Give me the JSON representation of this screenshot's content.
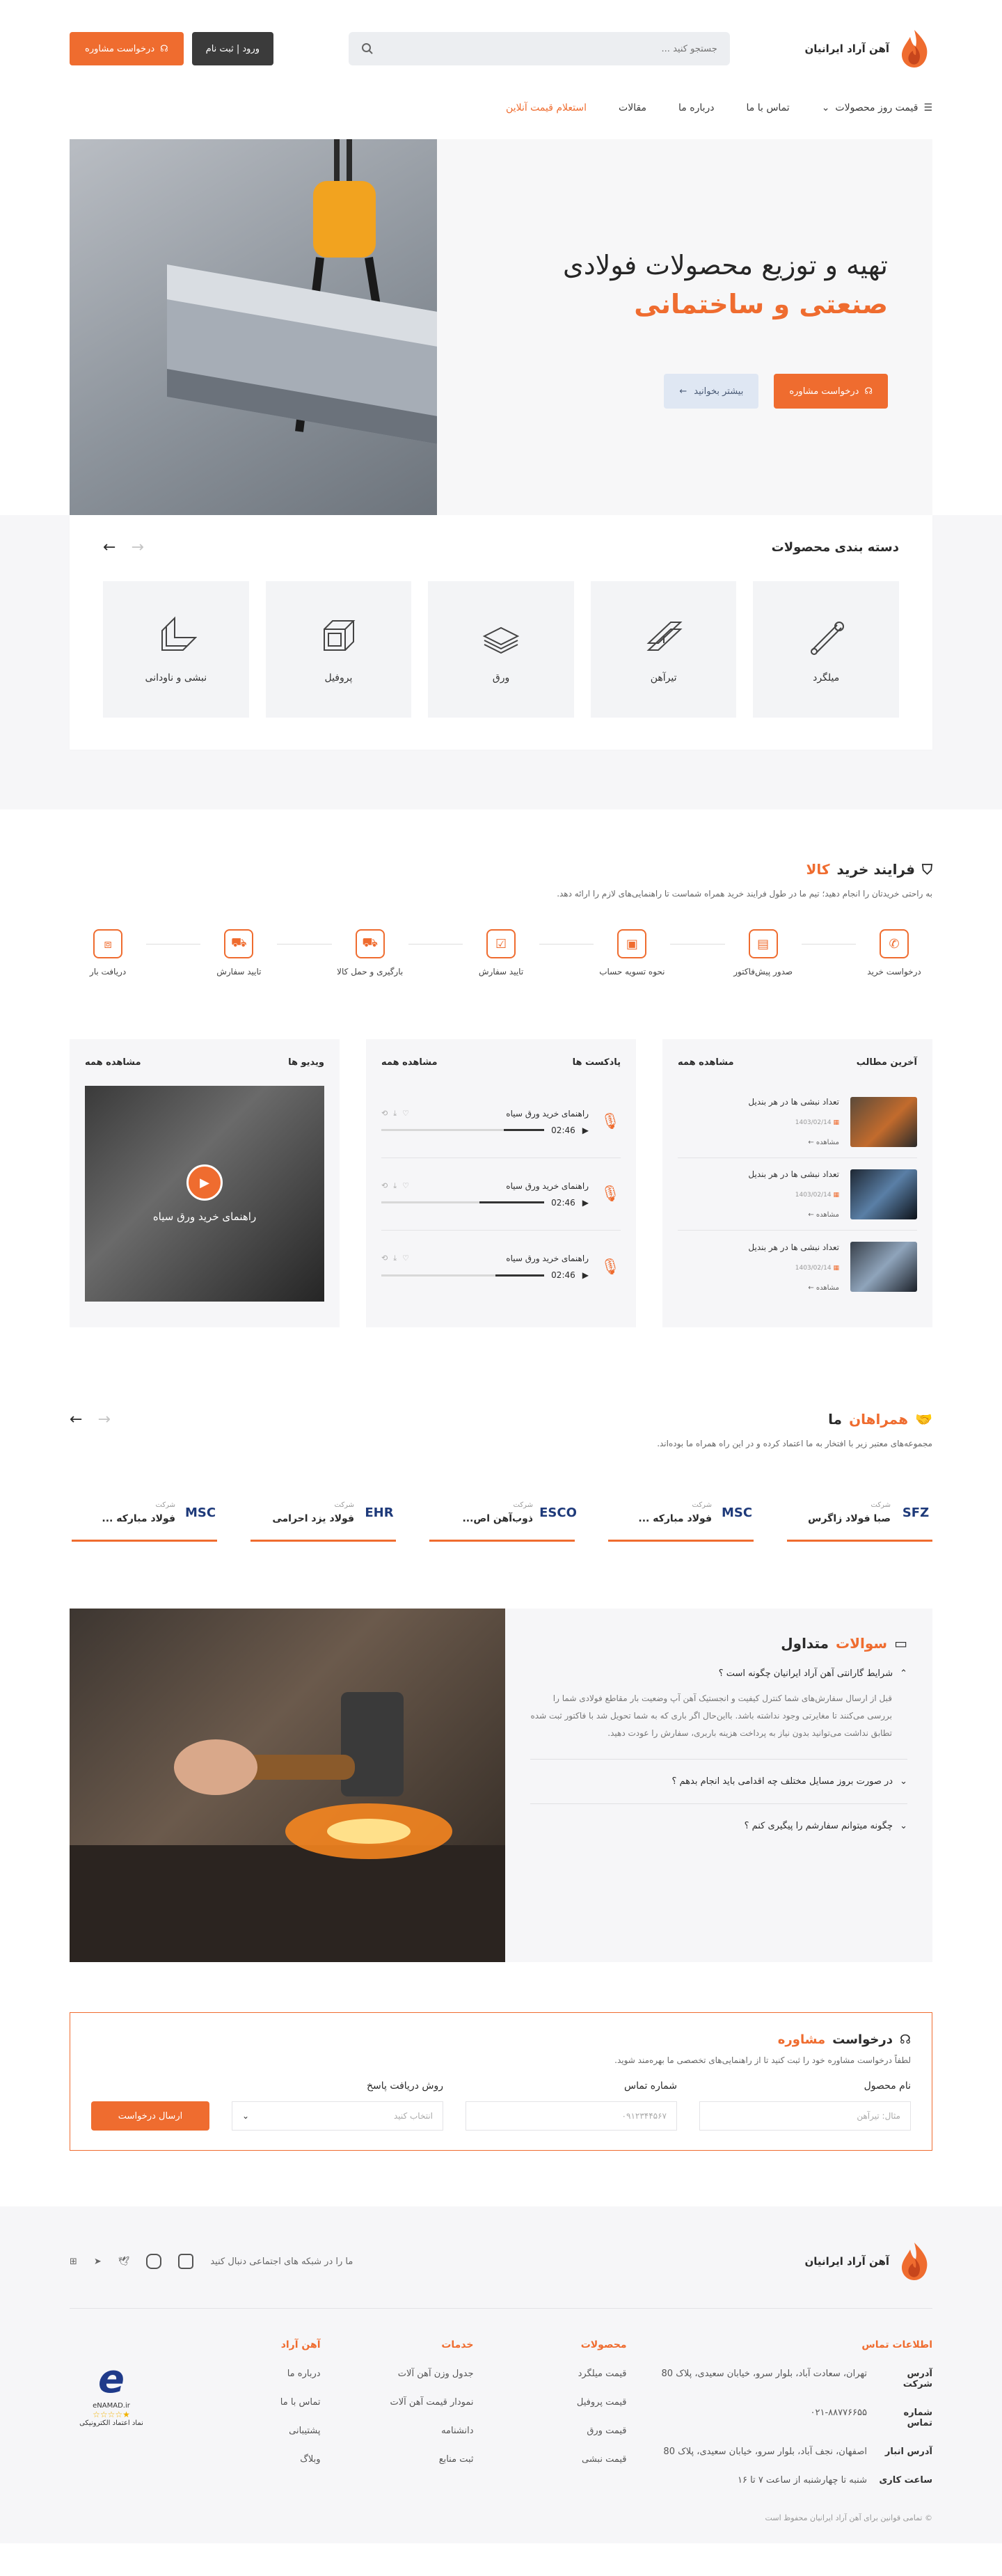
{
  "header": {
    "logo_text": "آهن آراد ایرانیان",
    "search_placeholder": "جستجو کنید ...",
    "login_label": "ورود | ثبت نام",
    "consult_label": "درخواست مشاوره"
  },
  "nav": {
    "items": [
      {
        "label": "قیمت روز محصولات"
      },
      {
        "label": "تماس با ما"
      },
      {
        "label": "درباره ما"
      },
      {
        "label": "مقالات"
      },
      {
        "label": "استعلام قیمت آنلاین"
      }
    ]
  },
  "hero": {
    "line1": "تهیه و توزیع محصولات فولادی",
    "line2": "صنعتی و ساختمانی",
    "consult_label": "درخواست مشاوره",
    "more_label": "بیشتر بخوانید"
  },
  "categories": {
    "title": "دسته بندی محصولات",
    "items": [
      {
        "label": "میلگرد"
      },
      {
        "label": "تیرآهن"
      },
      {
        "label": "ورق"
      },
      {
        "label": "پروفیل"
      },
      {
        "label": "نبشی و ناودانی"
      }
    ]
  },
  "process": {
    "title_a": "فرایند خرید",
    "title_b": "کالا",
    "desc": "به راحتی خریدتان را انجام دهید؛ تیم ما در طول فرایند خرید همراه شماست تا راهنمایی‌های لازم را ارائه دهد.",
    "steps": [
      {
        "label": "درخواست خرید"
      },
      {
        "label": "صدور پیش‌فاکتور"
      },
      {
        "label": "نحوه تسویه حساب"
      },
      {
        "label": "تایید سفارش"
      },
      {
        "label": "بارگیری و حمل کالا"
      },
      {
        "label": "تایید سفارش"
      },
      {
        "label": "دریافت بار"
      }
    ]
  },
  "articles": {
    "title": "آخرین مطالب",
    "more": "مشاهده همه",
    "items": [
      {
        "title": "تعداد نبشی ها در هر بندیل",
        "date": "1403/02/14",
        "view": "مشاهده"
      },
      {
        "title": "تعداد نبشی ها در هر بندیل",
        "date": "1403/02/14",
        "view": "مشاهده"
      },
      {
        "title": "تعداد نبشی ها در هر بندیل",
        "date": "1403/02/14",
        "view": "مشاهده"
      }
    ]
  },
  "podcasts": {
    "title": "پادکست ها",
    "more": "مشاهده همه",
    "items": [
      {
        "title": "راهنمای خرید ورق سیاه",
        "time": "02:46",
        "progress": 0.25
      },
      {
        "title": "راهنمای خرید ورق سیاه",
        "time": "02:46",
        "progress": 0.4
      },
      {
        "title": "راهنمای خرید ورق سیاه",
        "time": "02:46",
        "progress": 0.3
      }
    ]
  },
  "videos": {
    "title": "ویدیو ها",
    "more": "مشاهده همه",
    "caption": "راهنمای خرید ورق سیاه"
  },
  "partners": {
    "title_a": "همراهان",
    "title_b": "ما",
    "desc": "مجموعه‌های معتبر زیر با افتخار به ما اعتماد کرده و در این راه همراه ما بوده‌اند.",
    "company_label": "شرکت",
    "items": [
      {
        "name": "صبا فولاد زاگرس",
        "logo": "SFZ"
      },
      {
        "name": "فولاد مبارکه ...",
        "logo": "MSC"
      },
      {
        "name": "ذوب‌آهن اص...",
        "logo": "ESCO"
      },
      {
        "name": "فولاد یزد احرامی",
        "logo": "EHR"
      },
      {
        "name": "فولاد مبارکه ...",
        "logo": "MSC"
      }
    ]
  },
  "faq": {
    "title_a": "سوالات",
    "title_b": "متداول",
    "items": [
      {
        "q": "شرایط گارانتی آهن آراد ایرانیان چگونه است ؟",
        "a": "قبل از ارسال سفارش‌های شما کنترل کیفیت و انجستیک آهن آپ وضعیت بار مقاطع فولادی شما را بررسی می‌کنند تا مغایرتی وجود نداشته باشد. بااین‌حال اگر باری که به شما تحویل شد با فاکتور ثبت شده تطابق نداشت می‌توانید بدون نیاز به پرداخت هزینه باربری، سفارش را عودت دهید."
      },
      {
        "q": "در صورت بروز مسایل مختلف چه اقدامی باید انجام بدهم ؟",
        "a": ""
      },
      {
        "q": "چگونه میتوانم سفارشم را پیگیری کنم ؟",
        "a": ""
      }
    ]
  },
  "consult": {
    "title_a": "درخواست",
    "title_b": "مشاوره",
    "desc": "لطفاً درخواست مشاوره خود را ثبت کنید تا از راهنمایی‌های تخصصی ما بهره‌مند شوید.",
    "product_label": "نام محصول",
    "product_placeholder": "مثال: تیرآهن",
    "phone_label": "شماره تماس",
    "phone_placeholder": "۰۹۱۲۳۴۴۵۶۷",
    "method_label": "روش دریافت پاسخ",
    "method_placeholder": "انتخاب کنید",
    "submit": "ارسال درخواست"
  },
  "footer": {
    "logo_text": "آهن آراد ایرانیان",
    "social_text": "ما را در شبکه های اجتماعی دنبال کنید",
    "contact": {
      "title": "اطلاعات تماس",
      "rows": [
        {
          "k": "آدرس شرکت",
          "v": "تهران، سعادت آباد، بلوار سرو، خیابان سعیدی، پلاک 80"
        },
        {
          "k": "شماره تماس",
          "v": "۰۲۱-۸۸۷۷۶۶۵۵"
        },
        {
          "k": "آدرس انبار",
          "v": "اصفهان، نجف آباد، بلوار سرو، خیابان سعیدی، پلاک 80"
        },
        {
          "k": "ساعت کاری",
          "v": "شنبه تا چهارشنبه از ساعت ۷ تا ۱۶"
        }
      ]
    },
    "products": {
      "title": "محصولات",
      "items": [
        "قیمت میلگرد",
        "قیمت پروفیل",
        "قیمت ورق",
        "قیمت نبشی"
      ]
    },
    "services": {
      "title": "خدمات",
      "items": [
        "جدول وزن آهن آلات",
        "نمودار قیمت آهن آلات",
        "دانشنامه",
        "ثبت منابع"
      ]
    },
    "arad": {
      "title": "آهن آراد",
      "items": [
        "درباره ما",
        "تماس با ما",
        "پشتیبانی",
        "وبلاگ"
      ]
    },
    "enamad": {
      "brand": "e",
      "text": "eNAMAD.ir",
      "sub": "نماد اعتماد الکترونیکی"
    },
    "copyright": "تمامی قوانین برای آهن آراد ایرانیان محفوظ است"
  },
  "colors": {
    "accent": "#ef6c2f",
    "dark": "#3b3b3b",
    "panel": "#f6f6f8"
  }
}
